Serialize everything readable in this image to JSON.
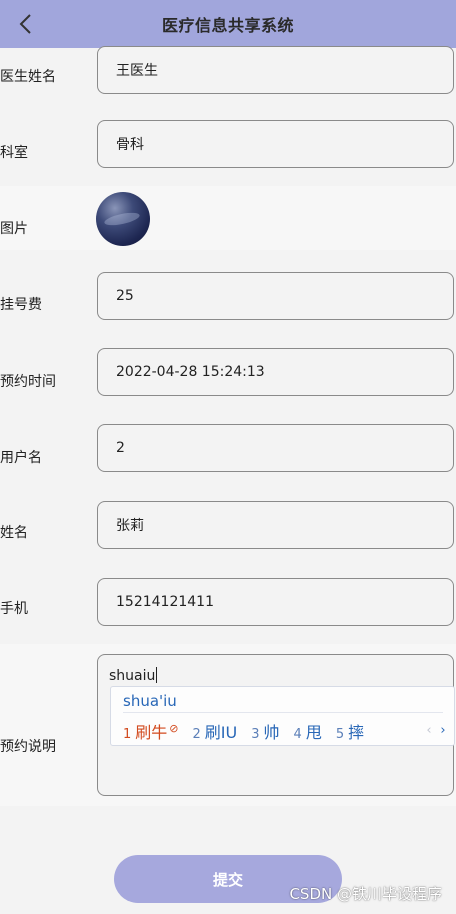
{
  "header": {
    "title": "医疗信息共享系统",
    "back_icon": "chevron-left-icon",
    "color": "#a1a6dc"
  },
  "form": {
    "doctor_name": {
      "label": "医生姓名",
      "value": "王医生"
    },
    "department": {
      "label": "科室",
      "value": "骨科"
    },
    "image": {
      "label": "图片"
    },
    "fee": {
      "label": "挂号费",
      "value": "25"
    },
    "appointment_time": {
      "label": "预约时间",
      "value": "2022-04-28 15:24:13"
    },
    "username": {
      "label": "用户名",
      "value": "2"
    },
    "name": {
      "label": "姓名",
      "value": "张莉"
    },
    "phone": {
      "label": "手机",
      "value": "15214121411"
    },
    "note": {
      "label": "预约说明",
      "value": "shuaiu"
    }
  },
  "ime": {
    "pinyin": "shua'iu",
    "candidates": [
      {
        "num": "1",
        "text": "刷牛"
      },
      {
        "num": "2",
        "text": "刷IU"
      },
      {
        "num": "3",
        "text": "帅"
      },
      {
        "num": "4",
        "text": "甩"
      },
      {
        "num": "5",
        "text": "摔"
      }
    ],
    "prev": "‹",
    "next": "›"
  },
  "submit": {
    "label": "提交",
    "color": "#a6a8dd"
  },
  "watermark": "CSDN @铁川毕设程序"
}
